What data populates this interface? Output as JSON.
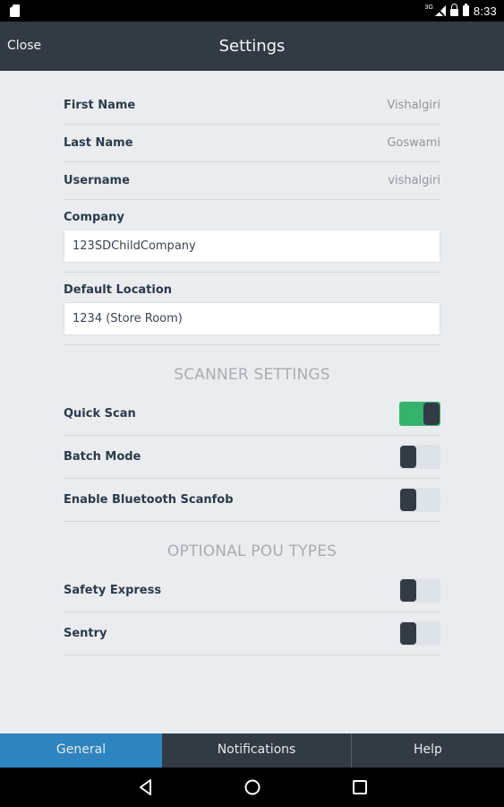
{
  "status_bar": {
    "network_label": "3G",
    "time": "8:33"
  },
  "app_bar": {
    "close_label": "Close",
    "title": "Settings"
  },
  "profile": {
    "first_name_label": "First Name",
    "first_name_value": "Vishalgiri",
    "last_name_label": "Last Name",
    "last_name_value": "Goswami",
    "username_label": "Username",
    "username_value": "vishalgiri",
    "company_label": "Company",
    "company_value": "123SDChildCompany",
    "default_location_label": "Default Location",
    "default_location_value": "1234 (Store Room)"
  },
  "scanner_settings": {
    "title": "SCANNER SETTINGS",
    "items": [
      {
        "label": "Quick Scan",
        "on": true
      },
      {
        "label": "Batch Mode",
        "on": false
      },
      {
        "label": "Enable Bluetooth Scanfob",
        "on": false
      }
    ]
  },
  "pou_types": {
    "title": "OPTIONAL POU TYPES",
    "items": [
      {
        "label": "Safety Express",
        "on": false
      },
      {
        "label": "Sentry",
        "on": false
      }
    ]
  },
  "tabs": {
    "general": "General",
    "notifications": "Notifications",
    "help": "Help",
    "active": "general"
  },
  "colors": {
    "app_bar": "#323a44",
    "toggle_on": "#35b36b",
    "tab_active": "#2d84be"
  },
  "icons": {
    "back": "back-triangle-icon",
    "home": "home-circle-icon",
    "recent": "recent-square-icon"
  }
}
